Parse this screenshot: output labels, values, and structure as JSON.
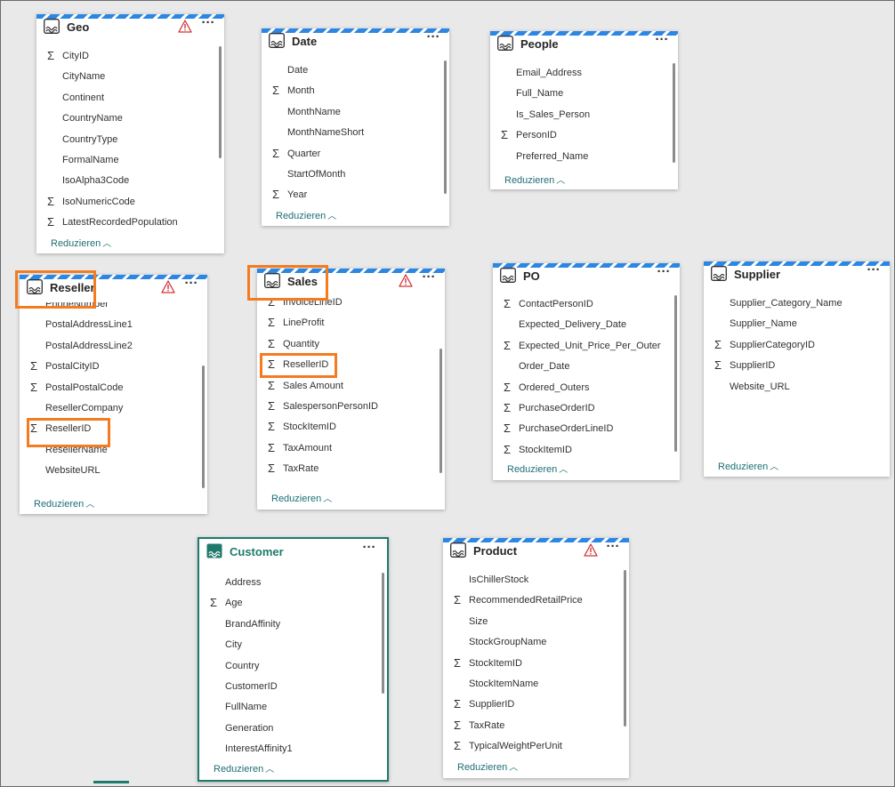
{
  "tables": {
    "geo": {
      "title": "Geo",
      "fields": [
        {
          "sigma": true,
          "name": "CityID"
        },
        {
          "sigma": false,
          "name": "CityName"
        },
        {
          "sigma": false,
          "name": "Continent"
        },
        {
          "sigma": false,
          "name": "CountryName"
        },
        {
          "sigma": false,
          "name": "CountryType"
        },
        {
          "sigma": false,
          "name": "FormalName"
        },
        {
          "sigma": false,
          "name": "IsoAlpha3Code"
        },
        {
          "sigma": true,
          "name": "IsoNumericCode"
        },
        {
          "sigma": true,
          "name": "LatestRecordedPopulation"
        }
      ],
      "reduce": "Reduzieren"
    },
    "date": {
      "title": "Date",
      "fields": [
        {
          "sigma": false,
          "name": "Date"
        },
        {
          "sigma": true,
          "name": "Month"
        },
        {
          "sigma": false,
          "name": "MonthName"
        },
        {
          "sigma": false,
          "name": "MonthNameShort"
        },
        {
          "sigma": true,
          "name": "Quarter"
        },
        {
          "sigma": false,
          "name": "StartOfMonth"
        },
        {
          "sigma": true,
          "name": "Year"
        }
      ],
      "reduce": "Reduzieren"
    },
    "people": {
      "title": "People",
      "fields": [
        {
          "sigma": false,
          "name": "Email_Address"
        },
        {
          "sigma": false,
          "name": "Full_Name"
        },
        {
          "sigma": false,
          "name": "Is_Sales_Person"
        },
        {
          "sigma": true,
          "name": "PersonID"
        },
        {
          "sigma": false,
          "name": "Preferred_Name"
        }
      ],
      "reduce": "Reduzieren"
    },
    "reseller": {
      "title": "Reseller",
      "fields": [
        {
          "sigma": false,
          "name": "PhoneNumber"
        },
        {
          "sigma": false,
          "name": "PostalAddressLine1"
        },
        {
          "sigma": false,
          "name": "PostalAddressLine2"
        },
        {
          "sigma": true,
          "name": "PostalCityID"
        },
        {
          "sigma": true,
          "name": "PostalPostalCode"
        },
        {
          "sigma": false,
          "name": "ResellerCompany"
        },
        {
          "sigma": true,
          "name": "ResellerID"
        },
        {
          "sigma": false,
          "name": "ResellerName"
        },
        {
          "sigma": false,
          "name": "WebsiteURL"
        }
      ],
      "reduce": "Reduzieren"
    },
    "sales": {
      "title": "Sales",
      "fields": [
        {
          "sigma": true,
          "name": "InvoiceLineID"
        },
        {
          "sigma": true,
          "name": "LineProfit"
        },
        {
          "sigma": true,
          "name": "Quantity"
        },
        {
          "sigma": true,
          "name": "ResellerID"
        },
        {
          "sigma": true,
          "name": "Sales Amount"
        },
        {
          "sigma": true,
          "name": "SalespersonPersonID"
        },
        {
          "sigma": true,
          "name": "StockItemID"
        },
        {
          "sigma": true,
          "name": "TaxAmount"
        },
        {
          "sigma": true,
          "name": "TaxRate"
        }
      ],
      "reduce": "Reduzieren"
    },
    "po": {
      "title": "PO",
      "fields": [
        {
          "sigma": true,
          "name": "ContactPersonID"
        },
        {
          "sigma": false,
          "name": "Expected_Delivery_Date"
        },
        {
          "sigma": true,
          "name": "Expected_Unit_Price_Per_Outer"
        },
        {
          "sigma": false,
          "name": "Order_Date"
        },
        {
          "sigma": true,
          "name": "Ordered_Outers"
        },
        {
          "sigma": true,
          "name": "PurchaseOrderID"
        },
        {
          "sigma": true,
          "name": "PurchaseOrderLineID"
        },
        {
          "sigma": true,
          "name": "StockItemID"
        }
      ],
      "reduce": "Reduzieren"
    },
    "supplier": {
      "title": "Supplier",
      "fields": [
        {
          "sigma": false,
          "name": "Supplier_Category_Name"
        },
        {
          "sigma": false,
          "name": "Supplier_Name"
        },
        {
          "sigma": true,
          "name": "SupplierCategoryID"
        },
        {
          "sigma": true,
          "name": "SupplierID"
        },
        {
          "sigma": false,
          "name": "Website_URL"
        }
      ],
      "reduce": "Reduzieren"
    },
    "customer": {
      "title": "Customer",
      "fields": [
        {
          "sigma": false,
          "name": "Address"
        },
        {
          "sigma": true,
          "name": "Age"
        },
        {
          "sigma": false,
          "name": "BrandAffinity"
        },
        {
          "sigma": false,
          "name": "City"
        },
        {
          "sigma": false,
          "name": "Country"
        },
        {
          "sigma": false,
          "name": "CustomerID"
        },
        {
          "sigma": false,
          "name": "FullName"
        },
        {
          "sigma": false,
          "name": "Generation"
        },
        {
          "sigma": false,
          "name": "InterestAffinity1"
        }
      ],
      "reduce": "Reduzieren"
    },
    "product": {
      "title": "Product",
      "fields": [
        {
          "sigma": false,
          "name": "IsChillerStock"
        },
        {
          "sigma": true,
          "name": "RecommendedRetailPrice"
        },
        {
          "sigma": false,
          "name": "Size"
        },
        {
          "sigma": false,
          "name": "StockGroupName"
        },
        {
          "sigma": true,
          "name": "StockItemID"
        },
        {
          "sigma": false,
          "name": "StockItemName"
        },
        {
          "sigma": true,
          "name": "SupplierID"
        },
        {
          "sigma": true,
          "name": "TaxRate"
        },
        {
          "sigma": true,
          "name": "TypicalWeightPerUnit"
        }
      ],
      "reduce": "Reduzieren"
    }
  },
  "icons": {
    "table": "table-icon",
    "warning": "warning-icon",
    "more": "more-options-icon",
    "sigma": "sigma-icon",
    "collapse": "chevron-up-icon"
  },
  "colors": {
    "stripe": "#2b87e3",
    "highlight": "#f47b20",
    "selected": "#1f7a6c",
    "warning": "#d13438",
    "link": "#1f6e75"
  }
}
